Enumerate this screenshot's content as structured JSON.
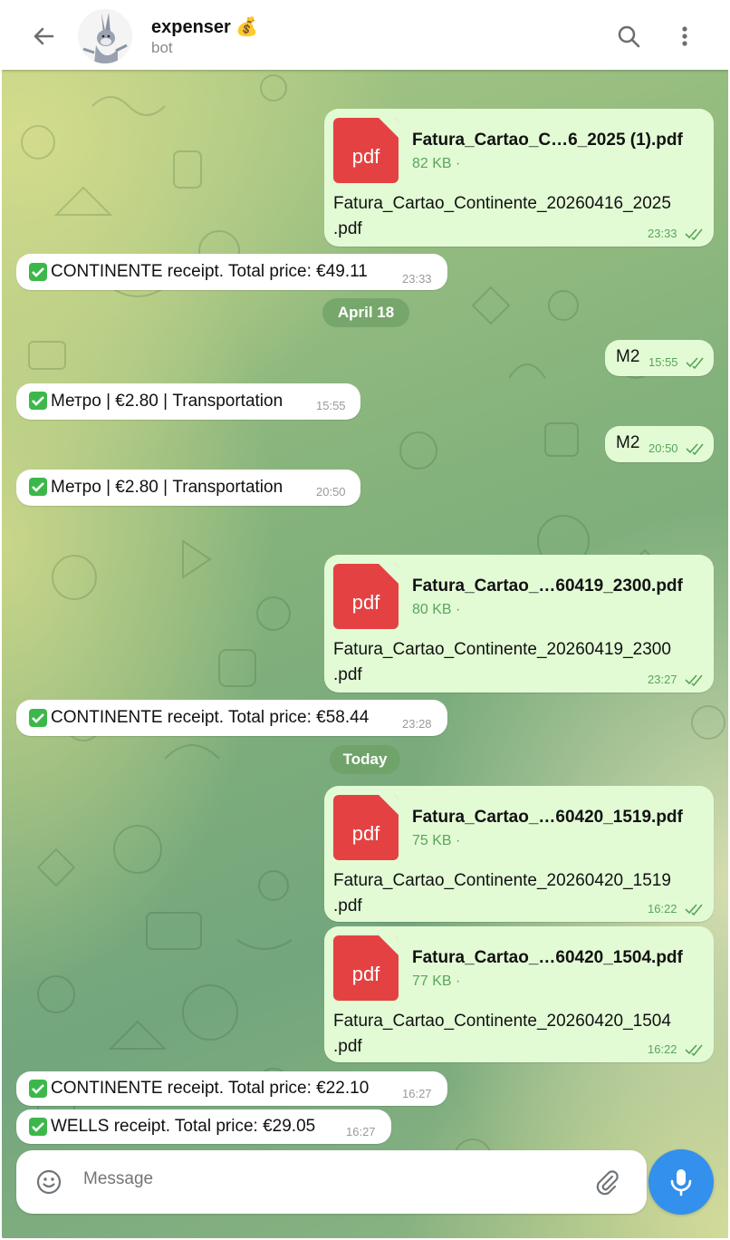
{
  "header": {
    "title": "expenser",
    "title_emoji": "💰",
    "subtitle": "bot",
    "icons": [
      "back-arrow-icon",
      "bot-avatar",
      "search-icon",
      "more-vertical-icon"
    ]
  },
  "colors": {
    "outgoing_bubble": "#e2fbd5",
    "incoming_bubble": "#ffffff",
    "time_outgoing": "#5aa55a",
    "accent": "#3390ec",
    "pdf": "#e44242"
  },
  "messages": {
    "m1": {
      "file_name": "Fatura_Cartao_C…6_2025 (1).pdf",
      "file_size": "82 KB ·",
      "file_type": "pdf",
      "caption_line1": "Fatura_Cartao_Continente_20260416_2025",
      "caption_line2": ".pdf",
      "time": "23:33"
    },
    "m2": {
      "text": "CONTINENTE receipt. Total price: €49.11",
      "time": "23:33"
    },
    "date1": "April 18",
    "m3": {
      "text": "M2",
      "time": "15:55"
    },
    "m4": {
      "text": "Метро | €2.80 | Transportation",
      "time": "15:55"
    },
    "m5": {
      "text": "M2",
      "time": "20:50"
    },
    "m6": {
      "text": "Метро | €2.80 | Transportation",
      "time": "20:50"
    },
    "m7": {
      "file_name": "Fatura_Cartao_…60419_2300.pdf",
      "file_size": "80 KB ·",
      "file_type": "pdf",
      "caption_line1": "Fatura_Cartao_Continente_20260419_2300",
      "caption_line2": ".pdf",
      "time": "23:27"
    },
    "m8": {
      "text": "CONTINENTE receipt. Total price: €58.44",
      "time": "23:28"
    },
    "date2": "Today",
    "m9": {
      "file_name": "Fatura_Cartao_…60420_1519.pdf",
      "file_size": "75 KB ·",
      "file_type": "pdf",
      "caption_line1": "Fatura_Cartao_Continente_20260420_1519",
      "caption_line2": ".pdf",
      "time": "16:22"
    },
    "m10": {
      "file_name": "Fatura_Cartao_…60420_1504.pdf",
      "file_size": "77 KB ·",
      "file_type": "pdf",
      "caption_line1": "Fatura_Cartao_Continente_20260420_1504",
      "caption_line2": ".pdf",
      "time": "16:22"
    },
    "m11": {
      "text": "CONTINENTE receipt. Total price: €22.10",
      "time": "16:27"
    },
    "m12": {
      "text": "WELLS receipt. Total price: €29.05",
      "time": "16:27"
    }
  },
  "composer": {
    "placeholder": "Message",
    "icons": [
      "emoji-icon",
      "attach-icon",
      "microphone-icon"
    ]
  }
}
